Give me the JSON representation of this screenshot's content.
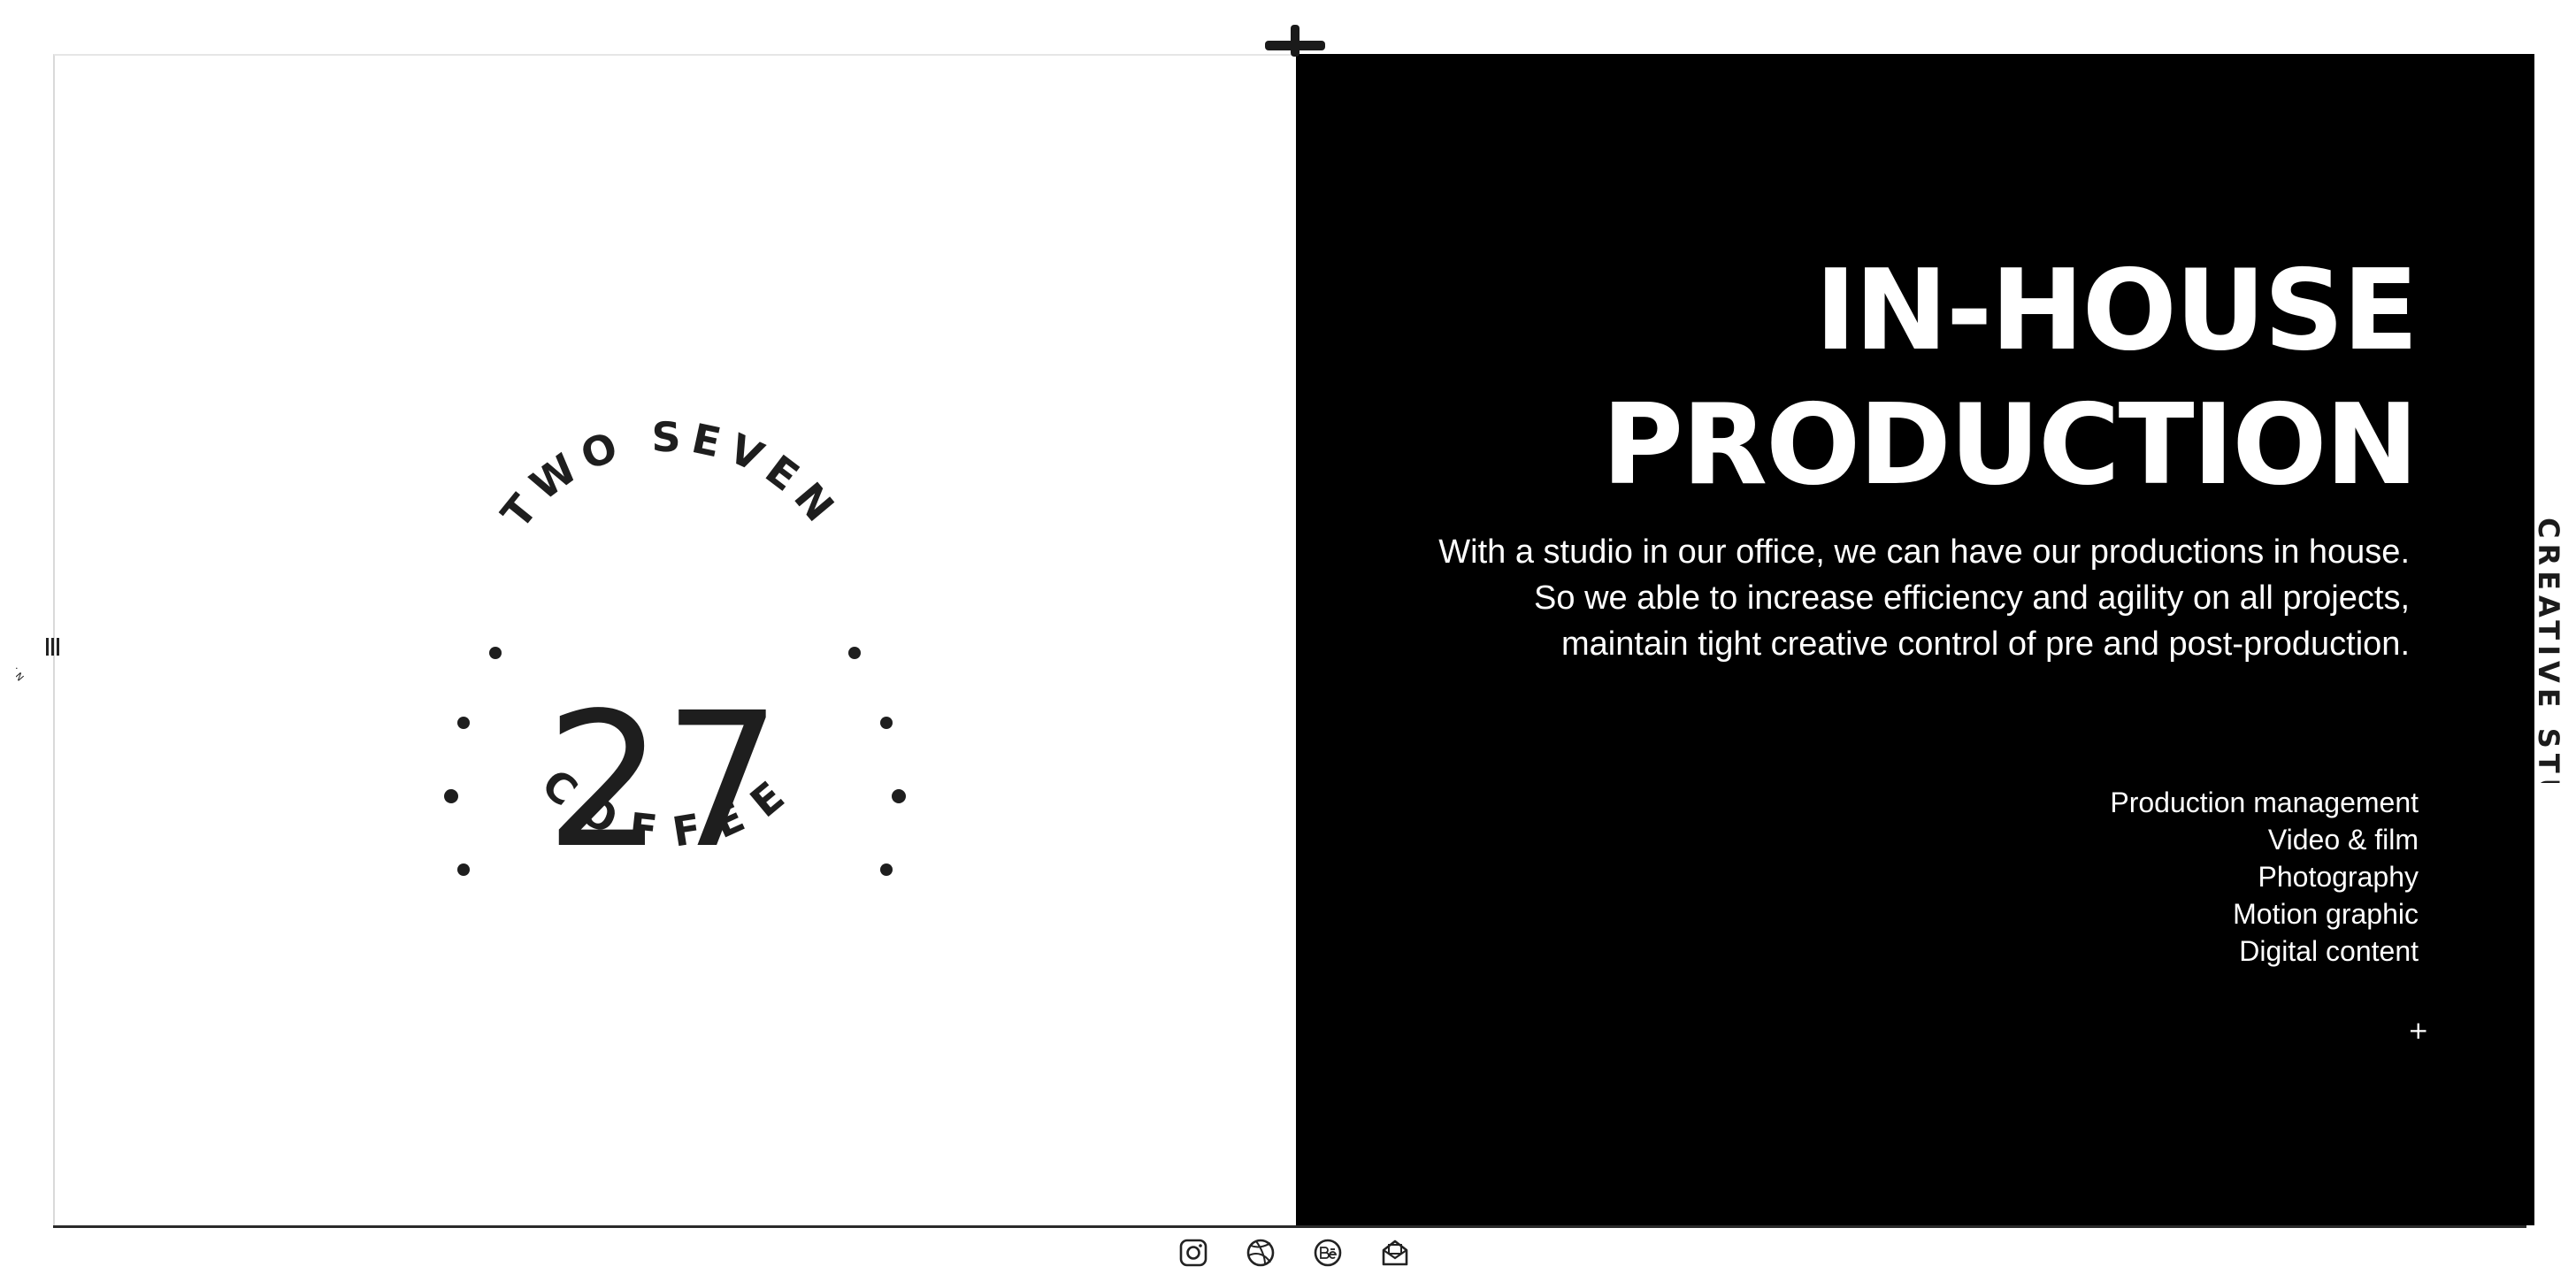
{
  "logo": {
    "top_text": "TWO SEVEN",
    "number": "27",
    "bottom_text": "COFFEE"
  },
  "nav": {
    "label": "NAVIG"
  },
  "side": {
    "label": "CREATIVE STUDIO"
  },
  "hero": {
    "title_line1": "IN-HOUSE",
    "title_line2": "PRODUCTION",
    "desc_line1": "With a studio in our office, we can have our productions in house.",
    "desc_line2": "So we able to increase efficiency and agility on all projects,",
    "desc_line3": "maintain tight creative control of pre and post-production."
  },
  "services": [
    "Production management",
    "Video & film",
    "Photography",
    "Motion graphic",
    "Digital content"
  ],
  "more_label": "+",
  "socials": [
    "instagram-icon",
    "dribbble-icon",
    "behance-icon",
    "mail-icon"
  ],
  "colors": {
    "dark": "#000000",
    "light": "#ffffff",
    "ink": "#1e1e1e"
  }
}
